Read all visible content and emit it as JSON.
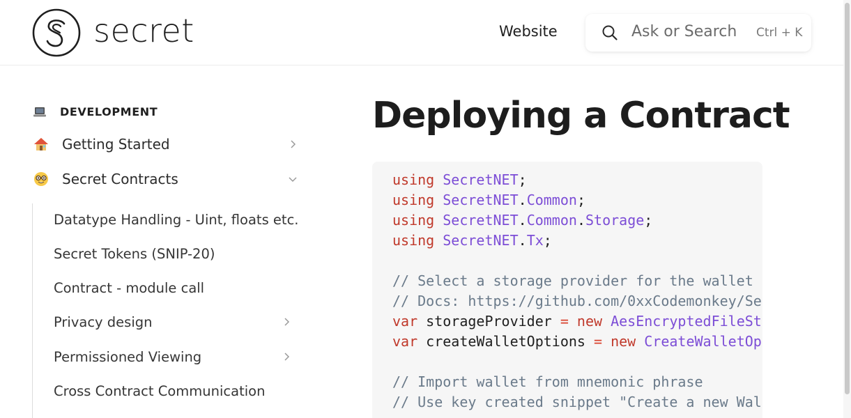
{
  "header": {
    "logo_text": "secret",
    "nav_website": "Website",
    "search_placeholder": "Ask or Search",
    "search_shortcut": "Ctrl + K"
  },
  "sidebar": {
    "section_label": "DEVELOPMENT",
    "items": [
      {
        "label": "Getting Started",
        "emoji": "house",
        "expanded": false
      },
      {
        "label": "Secret Contracts",
        "emoji": "nerd-face",
        "expanded": true
      }
    ],
    "sub_items": [
      {
        "label": "Datatype Handling - Uint, floats etc.",
        "has_children": false
      },
      {
        "label": "Secret Tokens (SNIP-20)",
        "has_children": false
      },
      {
        "label": "Contract - module call",
        "has_children": false
      },
      {
        "label": "Privacy design",
        "has_children": true
      },
      {
        "label": "Permissioned Viewing",
        "has_children": true
      },
      {
        "label": "Cross Contract Communication",
        "has_children": false
      }
    ]
  },
  "main": {
    "title": "Deploying a Contract",
    "code_lines": [
      [
        {
          "t": "kw",
          "v": "using"
        },
        {
          "t": "pn",
          "v": " "
        },
        {
          "t": "ty",
          "v": "SecretNET"
        },
        {
          "t": "pn",
          "v": ";"
        }
      ],
      [
        {
          "t": "kw",
          "v": "using"
        },
        {
          "t": "pn",
          "v": " "
        },
        {
          "t": "ty",
          "v": "SecretNET"
        },
        {
          "t": "pn",
          "v": "."
        },
        {
          "t": "ty",
          "v": "Common"
        },
        {
          "t": "pn",
          "v": ";"
        }
      ],
      [
        {
          "t": "kw",
          "v": "using"
        },
        {
          "t": "pn",
          "v": " "
        },
        {
          "t": "ty",
          "v": "SecretNET"
        },
        {
          "t": "pn",
          "v": "."
        },
        {
          "t": "ty",
          "v": "Common"
        },
        {
          "t": "pn",
          "v": "."
        },
        {
          "t": "ty",
          "v": "Storage"
        },
        {
          "t": "pn",
          "v": ";"
        }
      ],
      [
        {
          "t": "kw",
          "v": "using"
        },
        {
          "t": "pn",
          "v": " "
        },
        {
          "t": "ty",
          "v": "SecretNET"
        },
        {
          "t": "pn",
          "v": "."
        },
        {
          "t": "ty",
          "v": "Tx"
        },
        {
          "t": "pn",
          "v": ";"
        }
      ],
      [],
      [
        {
          "t": "cm",
          "v": "// Select a storage provider for the wallet"
        }
      ],
      [
        {
          "t": "cm",
          "v": "// Docs: https://github.com/0xxCodemonkey/Se"
        }
      ],
      [
        {
          "t": "kw",
          "v": "var"
        },
        {
          "t": "pn",
          "v": " storageProvider "
        },
        {
          "t": "op",
          "v": "="
        },
        {
          "t": "pn",
          "v": " "
        },
        {
          "t": "kw",
          "v": "new"
        },
        {
          "t": "pn",
          "v": " "
        },
        {
          "t": "ty",
          "v": "AesEncryptedFileSt"
        }
      ],
      [
        {
          "t": "kw",
          "v": "var"
        },
        {
          "t": "pn",
          "v": " createWalletOptions "
        },
        {
          "t": "op",
          "v": "="
        },
        {
          "t": "pn",
          "v": " "
        },
        {
          "t": "kw",
          "v": "new"
        },
        {
          "t": "pn",
          "v": " "
        },
        {
          "t": "ty",
          "v": "CreateWalletOp"
        }
      ],
      [],
      [
        {
          "t": "cm",
          "v": "// Import wallet from mnemonic phrase"
        }
      ],
      [
        {
          "t": "cm",
          "v": "// Use key created snippet \"Create a new Wal"
        }
      ]
    ]
  },
  "colors": {
    "keyword": "#c0392b",
    "type": "#7c4dd6",
    "comment": "#6a7a8a",
    "code_bg": "#f6f6f6"
  }
}
